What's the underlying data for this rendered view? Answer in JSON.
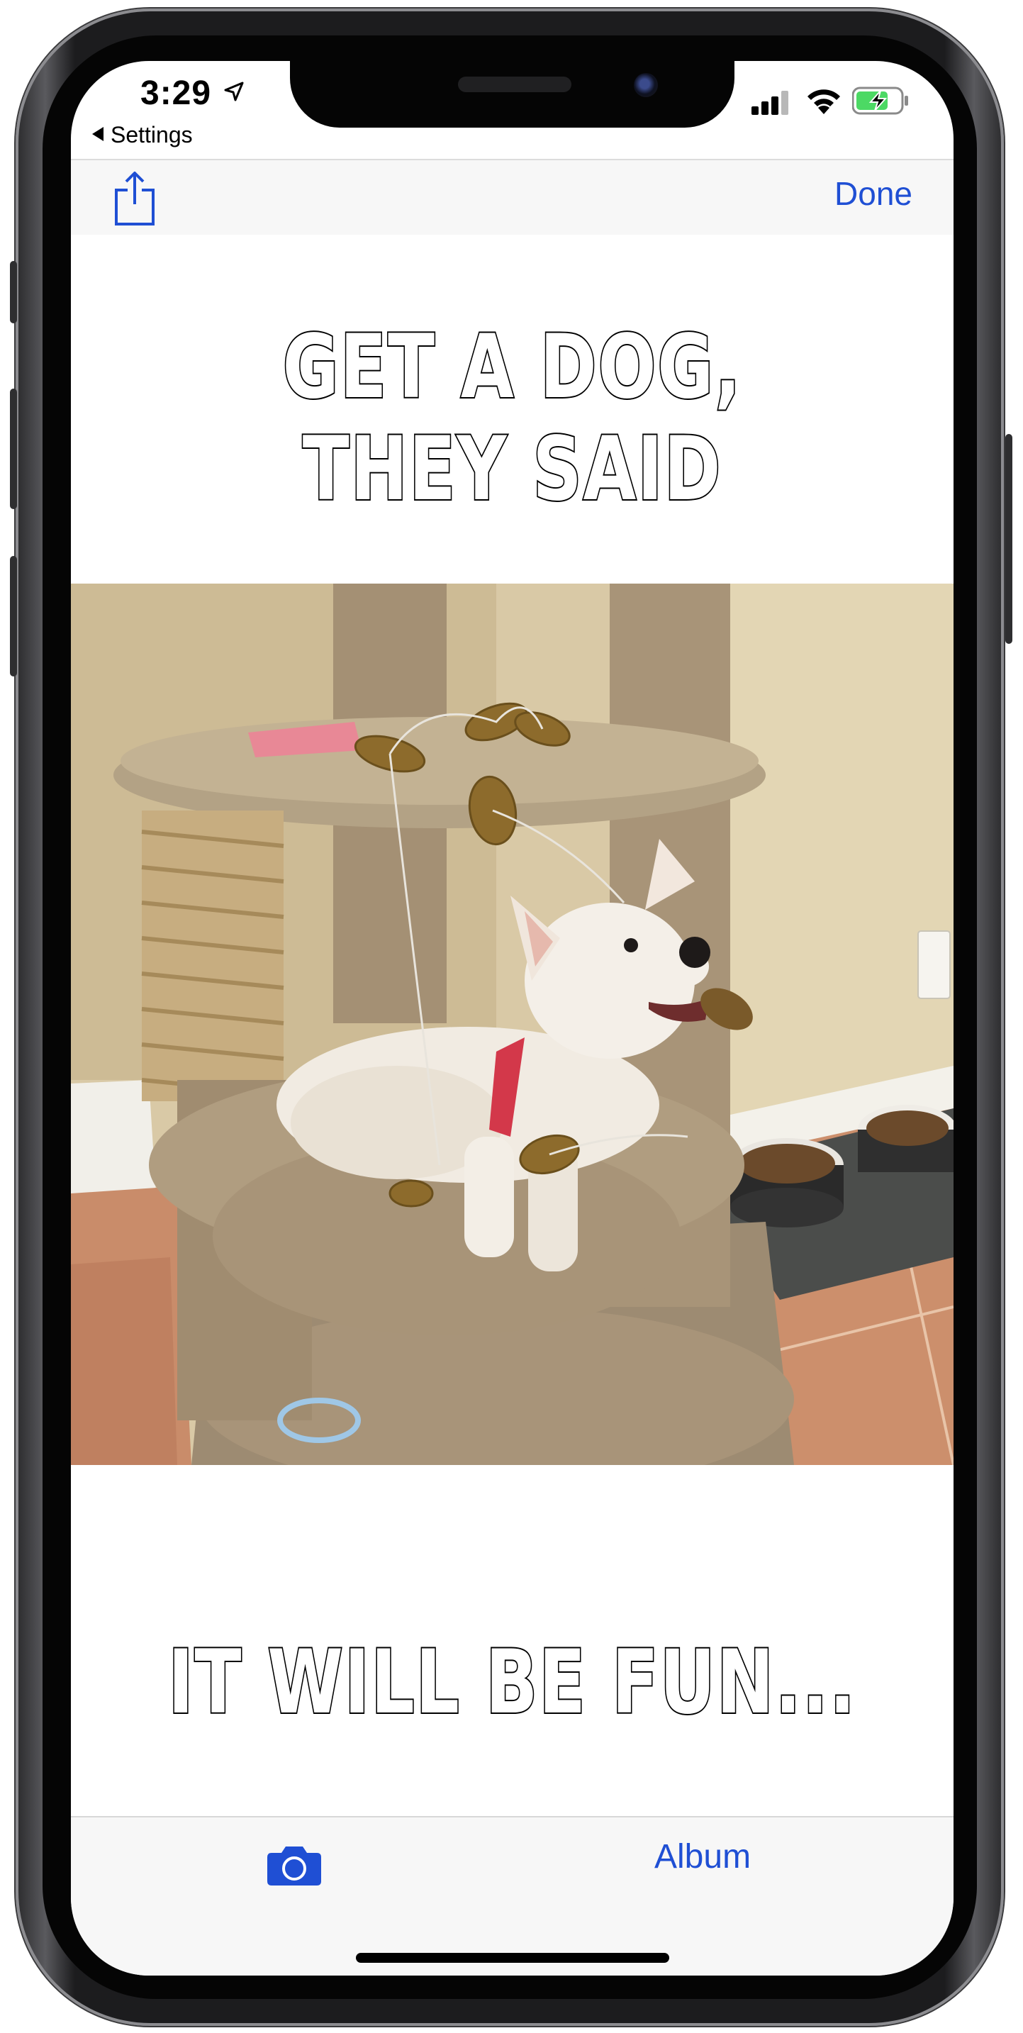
{
  "status_bar": {
    "time": "3:29",
    "back_label": "Settings",
    "icons": [
      "location-arrow-icon",
      "cellular-signal-icon",
      "wifi-icon",
      "battery-charging-icon"
    ]
  },
  "toolbar": {
    "share_icon": "share-icon",
    "done_label": "Done"
  },
  "meme": {
    "top_text": "GET A DOG, THEY SAID",
    "bottom_text": "IT WILL BE FUN...",
    "image_subject": "white dog lying on a cat tree"
  },
  "bottom_bar": {
    "camera_icon": "camera-icon",
    "album_label": "Album"
  },
  "colors": {
    "accent": "#1f4fd4",
    "bar_background": "#f7f7f7",
    "meme_text_fill": "#ffffff",
    "meme_text_stroke": "#000000"
  }
}
